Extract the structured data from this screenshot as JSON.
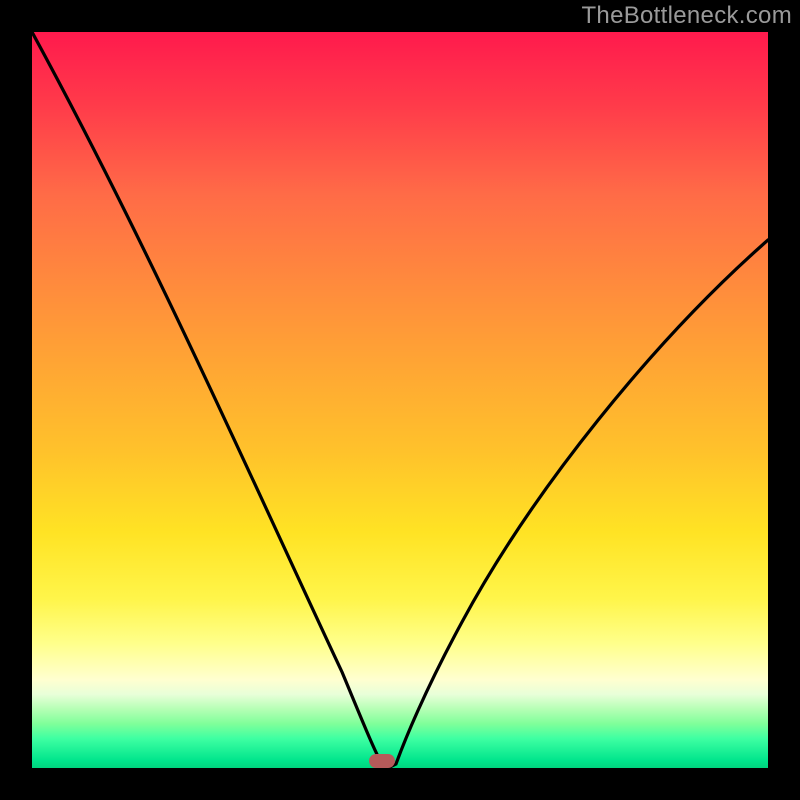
{
  "watermark": "TheBottleneck.com",
  "chart_data": {
    "type": "line",
    "title": "",
    "xlabel": "",
    "ylabel": "",
    "xlim": [
      0,
      1
    ],
    "ylim": [
      0,
      1
    ],
    "gradient_direction": "vertical",
    "gradient_stops": [
      {
        "pos": 0.0,
        "color": "#ff1a4d"
      },
      {
        "pos": 0.5,
        "color": "#ffb930"
      },
      {
        "pos": 0.8,
        "color": "#fff66a"
      },
      {
        "pos": 0.93,
        "color": "#d9ffd0"
      },
      {
        "pos": 1.0,
        "color": "#00d47e"
      }
    ],
    "series": [
      {
        "name": "curve",
        "x": [
          0.0,
          0.05,
          0.1,
          0.15,
          0.2,
          0.25,
          0.3,
          0.35,
          0.4,
          0.43,
          0.45,
          0.47,
          0.48,
          0.5,
          0.55,
          0.6,
          0.65,
          0.7,
          0.75,
          0.8,
          0.85,
          0.9,
          0.95,
          1.0
        ],
        "y": [
          1.0,
          0.88,
          0.76,
          0.64,
          0.52,
          0.41,
          0.3,
          0.19,
          0.09,
          0.04,
          0.02,
          0.01,
          0.0,
          0.01,
          0.06,
          0.13,
          0.21,
          0.3,
          0.39,
          0.48,
          0.57,
          0.63,
          0.68,
          0.72
        ]
      }
    ],
    "annotations": [
      {
        "name": "min-marker",
        "shape": "rounded-rect",
        "x": 0.475,
        "y": 0.005,
        "color": "#b65a5a"
      }
    ]
  }
}
